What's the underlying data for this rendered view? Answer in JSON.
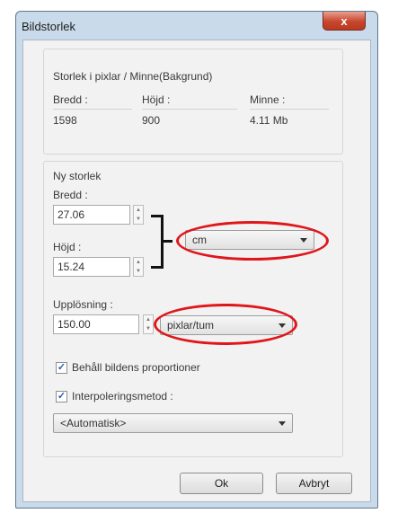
{
  "window": {
    "title": "Bildstorlek",
    "close_symbol": "x"
  },
  "pixel_size": {
    "heading": "Storlek i pixlar / Minne(Bakgrund)",
    "width_label": "Bredd :",
    "height_label": "Höjd :",
    "memory_label": "Minne :",
    "width_value": "1598",
    "height_value": "900",
    "memory_value": "4.11 Mb"
  },
  "new_size": {
    "heading": "Ny storlek",
    "width_label": "Bredd :",
    "width_value": "27.06",
    "height_label": "Höjd :",
    "height_value": "15.24",
    "unit_selected": "cm",
    "resolution_label": "Upplösning :",
    "resolution_value": "150.00",
    "resolution_unit_selected": "pixlar/tum",
    "keep_proportions_label": "Behåll bildens proportioner",
    "keep_proportions_checked": true,
    "interpolation_label": "Interpoleringsmetod :",
    "interpolation_checked": true,
    "interpolation_selected": "<Automatisk>"
  },
  "buttons": {
    "ok": "Ok",
    "cancel": "Avbryt"
  },
  "colors": {
    "highlight": "#e0161b",
    "window_frame": "#c9daea",
    "close_button": "#c9462d"
  }
}
